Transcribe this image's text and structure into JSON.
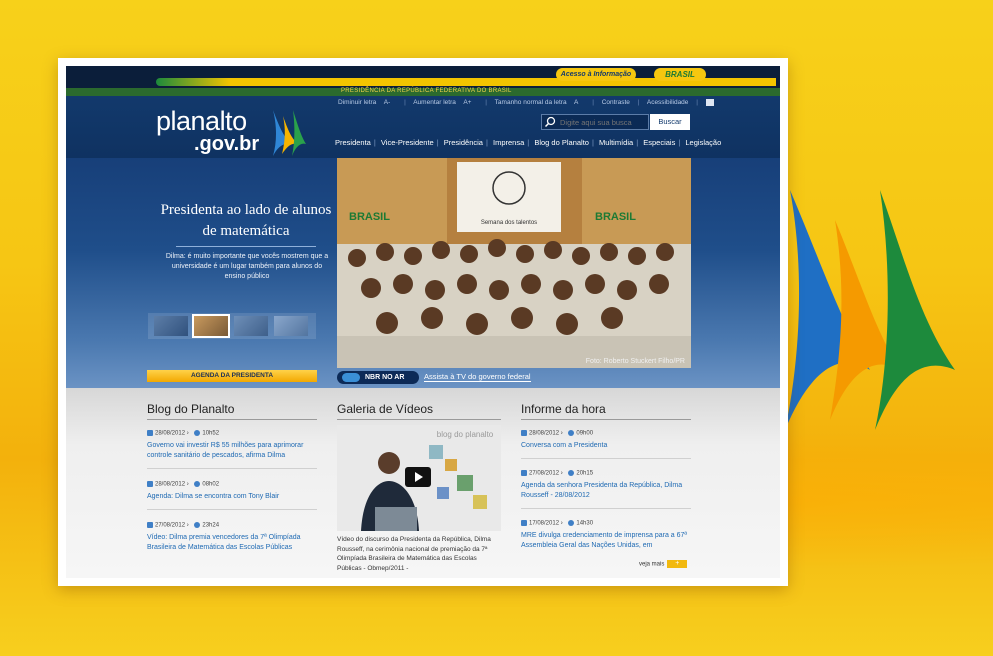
{
  "colors": {
    "background": "#f6c614",
    "navy": "#12396c",
    "gold": "#f3c400",
    "green": "#1d7a34",
    "link_blue": "#1f6ab3"
  },
  "topbar": {
    "acesso_label": "Acesso à Informação",
    "brasil_label": "BRASIL",
    "gov_label": "PRESIDÊNCIA DA REPÚBLICA FEDERATIVA DO BRASIL"
  },
  "header": {
    "logo_line1": "planalto",
    "logo_line2": ".gov.br",
    "access_links": [
      {
        "label": "Diminuir letra",
        "key": "A-"
      },
      {
        "label": "Aumentar letra",
        "key": "A+"
      },
      {
        "label": "Tamanho normal da letra",
        "key": "A"
      },
      {
        "label": "Contraste",
        "key": ""
      },
      {
        "label": "Acessibilidade",
        "key": ""
      }
    ],
    "search_placeholder": "Digite aqui sua busca",
    "search_button": "Buscar",
    "nav": [
      "Presidenta",
      "Vice-Presidente",
      "Presidência",
      "Imprensa",
      "Blog do Planalto",
      "Multimídia",
      "Especiais",
      "Legislação"
    ]
  },
  "hero": {
    "title": "Presidenta ao lado de alunos de matemática",
    "description": "Dilma: é muito importante que vocês mostrem que a universidade é um lugar também para alunos do ensino público",
    "photo_credit": "Foto: Roberto Stuckert Filho/PR",
    "agenda_button": "AGENDA DA PRESIDENTA",
    "nbr_label": "NBR NO AR",
    "tv_link": "Assista à TV do governo federal",
    "photo_banner_left": "BRASIL",
    "photo_banner_right": "BRASIL",
    "photo_screen_text": "Semana dos talentos"
  },
  "blog": {
    "title": "Blog do Planalto",
    "items": [
      {
        "date": "28/08/2012",
        "time": "10h52",
        "text": "Governo vai investir R$ 55 milhões para aprimorar controle sanitário de pescados, afirma Dilma"
      },
      {
        "date": "28/08/2012",
        "time": "08h02",
        "text": "Agenda: Dilma se encontra com Tony Blair"
      },
      {
        "date": "27/08/2012",
        "time": "23h24",
        "text": "Vídeo: Dilma premia vencedores da 7ª Olimpíada Brasileira de Matemática das Escolas Públicas"
      }
    ]
  },
  "videos": {
    "title": "Galeria de Vídeos",
    "video_watermark": "blog do planalto",
    "description": "Vídeo do discurso da Presidenta da República, Dilma Rousseff, na cerimônia nacional de premiação da 7ª Olimpíada Brasileira de Matemática das Escolas Públicas - Obmep/2011 -"
  },
  "informe": {
    "title": "Informe da hora",
    "items": [
      {
        "date": "28/08/2012",
        "time": "09h00",
        "text": "Conversa com a Presidenta"
      },
      {
        "date": "27/08/2012",
        "time": "20h15",
        "text": "Agenda da senhora Presidenta da República, Dilma Rousseff - 28/08/2012"
      },
      {
        "date": "17/08/2012",
        "time": "14h30",
        "text": "MRE divulga credenciamento de imprensa para a 67ª Assembleia Geral das Nações Unidas, em"
      }
    ],
    "more_label": "veja mais",
    "more_icon": "+"
  }
}
